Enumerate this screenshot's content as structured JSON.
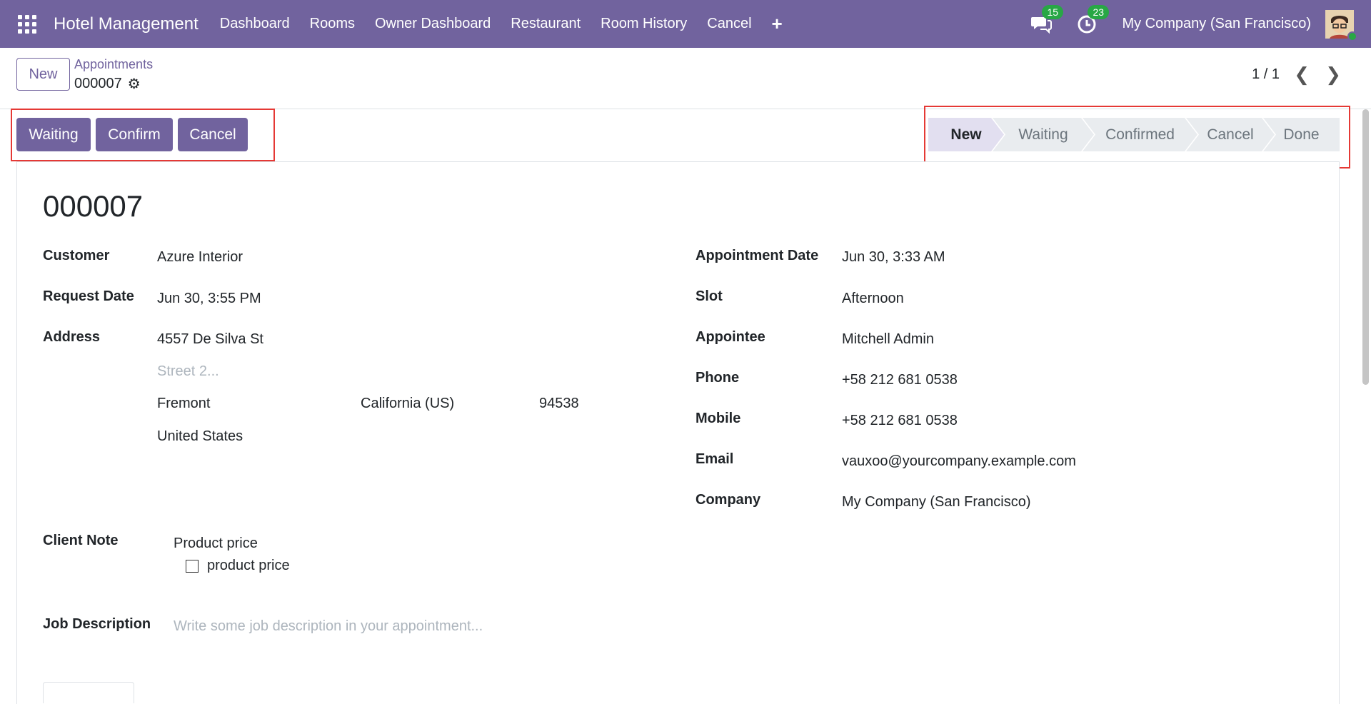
{
  "navbar": {
    "brand": "Hotel Management",
    "menu": [
      "Dashboard",
      "Rooms",
      "Owner Dashboard",
      "Restaurant",
      "Room History",
      "Cancel"
    ],
    "plus_icon": "+",
    "messages_count": "15",
    "activities_count": "23",
    "company": "My Company (San Francisco)",
    "colors": {
      "primary": "#71639e",
      "badge": "#28a745"
    }
  },
  "control": {
    "new_label": "New",
    "breadcrumb_parent": "Appointments",
    "breadcrumb_current": "000007",
    "pager": "1 / 1"
  },
  "actions": {
    "waiting": "Waiting",
    "confirm": "Confirm",
    "cancel": "Cancel"
  },
  "stages": [
    {
      "label": "New",
      "active": true
    },
    {
      "label": "Waiting",
      "active": false
    },
    {
      "label": "Confirmed",
      "active": false
    },
    {
      "label": "Cancel",
      "active": false
    },
    {
      "label": "Done",
      "active": false
    }
  ],
  "record": {
    "title": "000007",
    "left": {
      "customer_label": "Customer",
      "customer": "Azure Interior",
      "request_date_label": "Request Date",
      "request_date": "Jun 30, 3:55 PM",
      "address_label": "Address",
      "street": "4557 De Silva St",
      "street2_placeholder": "Street 2...",
      "city": "Fremont",
      "state": "California (US)",
      "zip": "94538",
      "country": "United States"
    },
    "right": {
      "appointment_date_label": "Appointment Date",
      "appointment_date": "Jun 30, 3:33 AM",
      "slot_label": "Slot",
      "slot": "Afternoon",
      "appointee_label": "Appointee",
      "appointee": "Mitchell Admin",
      "phone_label": "Phone",
      "phone": "+58 212 681 0538",
      "mobile_label": "Mobile",
      "mobile": "+58 212 681 0538",
      "email_label": "Email",
      "email": "vauxoo@yourcompany.example.com",
      "company_label": "Company",
      "company": "My Company (San Francisco)"
    },
    "client_note_label": "Client Note",
    "client_note_line1": "Product price",
    "client_note_checklist": "product price",
    "job_description_label": "Job Description",
    "job_description_placeholder": "Write some job description in your appointment..."
  }
}
